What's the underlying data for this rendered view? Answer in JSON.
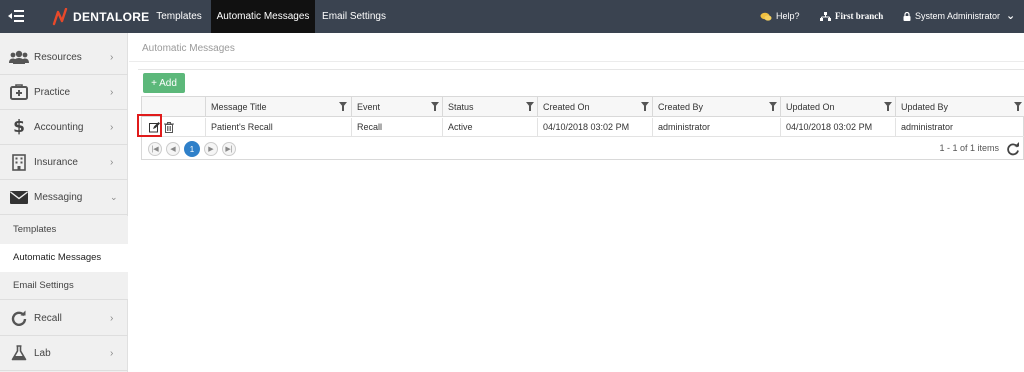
{
  "app": {
    "name": "DENTALORE",
    "brand_color": "#e8492a",
    "topbar_color": "#3a4350"
  },
  "top_tabs": [
    {
      "label": "Templates",
      "active": false
    },
    {
      "label": "Automatic Messages",
      "active": true
    },
    {
      "label": "Email Settings",
      "active": false
    }
  ],
  "top_right": {
    "help": "Help?",
    "branch": "First branch",
    "user": "System Administrator"
  },
  "sidebar": {
    "items": [
      {
        "label": "Resources",
        "icon": "users-icon"
      },
      {
        "label": "Practice",
        "icon": "medkit-icon"
      },
      {
        "label": "Accounting",
        "icon": "dollar-icon"
      },
      {
        "label": "Insurance",
        "icon": "building-icon"
      },
      {
        "label": "Messaging",
        "icon": "envelope-icon",
        "expanded": true
      },
      {
        "label": "Recall",
        "icon": "refresh-icon"
      },
      {
        "label": "Lab",
        "icon": "flask-icon"
      }
    ],
    "sub_items": [
      {
        "label": "Templates",
        "active": false
      },
      {
        "label": "Automatic Messages",
        "active": true
      },
      {
        "label": "Email Settings",
        "active": false
      }
    ]
  },
  "page": {
    "title": "Automatic Messages",
    "add_label": "+ Add",
    "add_color": "#5cb87a"
  },
  "grid": {
    "columns": [
      "Message Title",
      "Event",
      "Status",
      "Created On",
      "Created By",
      "Updated On",
      "Updated By"
    ],
    "rows": [
      {
        "message_title": "Patient's Recall",
        "event": "Recall",
        "status": "Active",
        "created_on": "04/10/2018 03:02 PM",
        "created_by": "administrator",
        "updated_on": "04/10/2018 03:02 PM",
        "updated_by": "administrator"
      }
    ],
    "pager": {
      "current_page": "1",
      "info": "1 - 1 of 1 items"
    }
  }
}
